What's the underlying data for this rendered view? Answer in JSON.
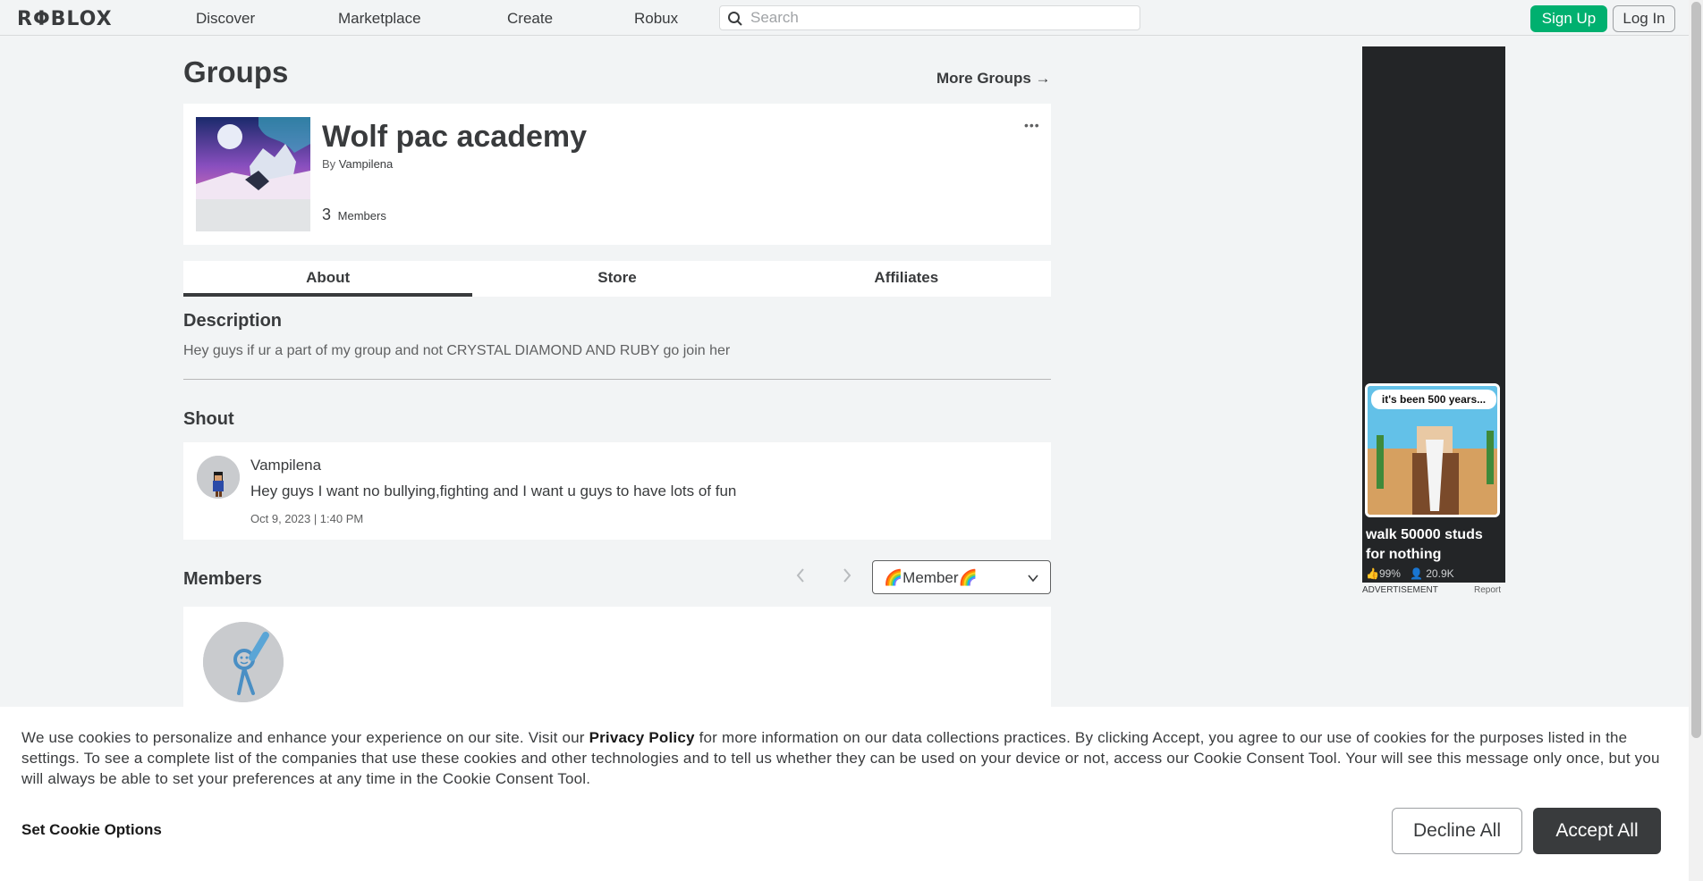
{
  "nav": {
    "logo": "RΦBLOX",
    "links": [
      "Discover",
      "Marketplace",
      "Create",
      "Robux"
    ],
    "search_placeholder": "Search",
    "signup": "Sign Up",
    "login": "Log In"
  },
  "page": {
    "title": "Groups",
    "more_groups": "More Groups →"
  },
  "group": {
    "name": "Wolf pac academy",
    "by_label": "By",
    "owner": "Vampilena",
    "member_count": "3",
    "members_label": "Members",
    "more": "•••"
  },
  "tabs": [
    "About",
    "Store",
    "Affiliates"
  ],
  "about": {
    "description_heading": "Description",
    "description": "Hey guys if ur a part of my group and not CRYSTAL DIAMOND AND RUBY go join her",
    "shout_heading": "Shout",
    "shout": {
      "user": "Vampilena",
      "text": "Hey guys I want no bullying,fighting and I want u guys to have lots of fun",
      "date": "Oct 9, 2023 | 1:40 PM"
    },
    "members_heading": "Members",
    "role_selected": "🌈Member🌈"
  },
  "ad": {
    "bubble": "it's been 500 years...",
    "title": "walk 50000 studs for nothing",
    "rating": "👍99%",
    "players": "👤 20.9K",
    "label": "ADVERTISEMENT",
    "report": "Report"
  },
  "cookie": {
    "text_before": "We use cookies to personalize and enhance your experience on our site. Visit our ",
    "privacy_link": "Privacy Policy",
    "text_after": " for more information on our data collections practices. By clicking Accept, you agree to our use of cookies for the purposes listed in the settings. To see a complete list of the companies that use these cookies and other technologies and to tell us whether they can be used on your device or not, access our Cookie Consent Tool. Your will see this message only once, but you will always be able to set your preferences at any time in the Cookie Consent Tool.",
    "set_options": "Set Cookie Options",
    "decline": "Decline All",
    "accept": "Accept All"
  },
  "colors": {
    "accent_green": "#00b06f",
    "text_dark": "#393b3d",
    "page_bg": "#f2f4f5"
  }
}
